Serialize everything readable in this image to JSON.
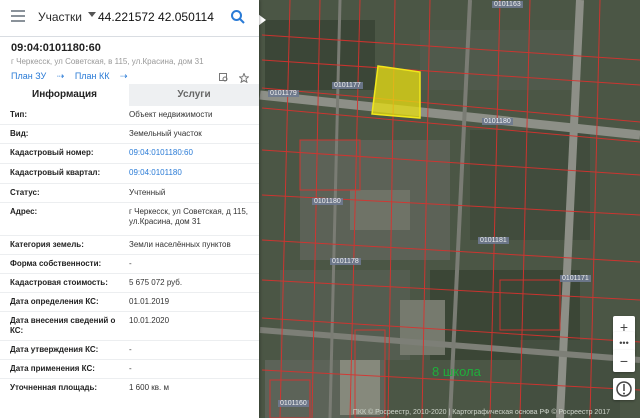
{
  "search": {
    "type_label": "Участки",
    "query": "44.221572 42.050114"
  },
  "object": {
    "cad_number": "09:04:0101180:60",
    "address_short": "г Черкесск, ул Советская, в 115, ул.Красина, дом 31"
  },
  "plans": {
    "zu": "План ЗУ",
    "kk": "План КК"
  },
  "tabs": {
    "info": "Информация",
    "services": "Услуги"
  },
  "info": [
    {
      "label": "Тип:",
      "value": "Объект недвижимости",
      "link": false
    },
    {
      "label": "Вид:",
      "value": "Земельный участок",
      "link": false
    },
    {
      "label": "Кадастровый номер:",
      "value": "09:04:0101180:60",
      "link": true
    },
    {
      "label": "Кадастровый квартал:",
      "value": "09:04:0101180",
      "link": true
    },
    {
      "label": "Статус:",
      "value": "Учтенный",
      "link": false
    },
    {
      "label": "Адрес:",
      "value": "г Черкесск, ул Советская, д 115, ул.Красина, дом 31",
      "link": false
    },
    {
      "label": "Категория земель:",
      "value": "Земли населённых пунктов",
      "link": false
    },
    {
      "label": "Форма собственности:",
      "value": "-",
      "link": false
    },
    {
      "label": "Кадастровая стоимость:",
      "value": "5 675 072 руб.",
      "link": false
    },
    {
      "label": "Дата определения КС:",
      "value": "01.01.2019",
      "link": false
    },
    {
      "label": "Дата внесения сведений о КС:",
      "value": "10.01.2020",
      "link": false
    },
    {
      "label": "Дата утверждения КС:",
      "value": "-",
      "link": false
    },
    {
      "label": "Дата применения КС:",
      "value": "-",
      "link": false
    },
    {
      "label": "Уточненная площадь:",
      "value": "1 600 кв. м",
      "link": false
    }
  ],
  "map": {
    "school_label": "8 школа",
    "copyright": "ПКК © Росреестр, 2010-2020 | Картографическая основа РФ © Росреестр 2017",
    "labels": [
      "0101180",
      "0101180",
      "0101181",
      "0101163",
      "0101177",
      "0101179",
      "0101171",
      "0101178",
      "0101160"
    ],
    "controls": {
      "zoom_in": "+",
      "more": "•••",
      "zoom_out": "−"
    },
    "parcel_color": "#e8df12"
  }
}
